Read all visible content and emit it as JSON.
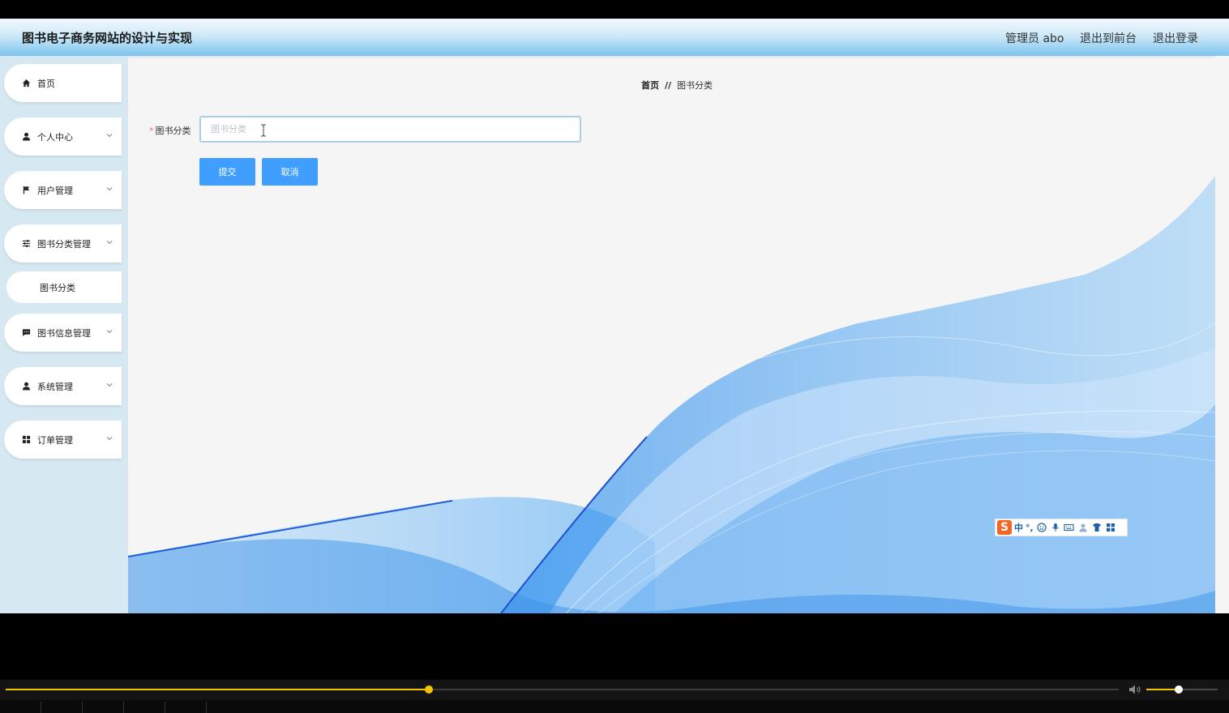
{
  "header": {
    "site_title": "图书电子商务网站的设计与实现",
    "user_label": "管理员 abo",
    "front_link": "退出到前台",
    "logout_link": "退出登录"
  },
  "sidebar": {
    "items": [
      {
        "label": "首页",
        "icon": "home-icon",
        "has_chevron": false
      },
      {
        "label": "个人中心",
        "icon": "user-icon",
        "has_chevron": true
      },
      {
        "label": "用户管理",
        "icon": "flag-icon",
        "has_chevron": true
      },
      {
        "label": "图书分类管理",
        "icon": "sliders-icon",
        "has_chevron": true
      },
      {
        "label": "图书信息管理",
        "icon": "chat-icon",
        "has_chevron": true
      },
      {
        "label": "系统管理",
        "icon": "user-icon",
        "has_chevron": true
      },
      {
        "label": "订单管理",
        "icon": "grid-icon",
        "has_chevron": true
      }
    ],
    "sub_items": [
      {
        "label": "图书分类",
        "parent": "图书分类管理"
      }
    ]
  },
  "breadcrumb": {
    "home": "首页",
    "separator": "//",
    "current": "图书分类"
  },
  "form": {
    "required_mark": "*",
    "label": "图书分类",
    "placeholder": "图书分类",
    "value": "",
    "submit_label": "提交",
    "cancel_label": "取消"
  },
  "ime_toolbar": {
    "logo": "S",
    "mode": "中",
    "punct": "°,"
  },
  "player": {
    "progress": 0.38,
    "volume": 0.45
  },
  "colors": {
    "primary": "#409eff",
    "header_gradient_end": "#7cc4ee",
    "sidebar_bg": "#d6e8f2",
    "progress": "#f5c400"
  }
}
